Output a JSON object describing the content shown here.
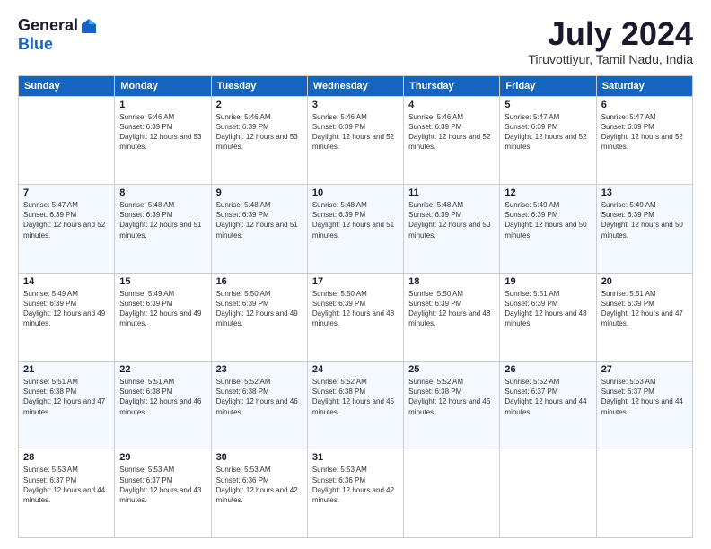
{
  "header": {
    "logo_general": "General",
    "logo_blue": "Blue",
    "month_title": "July 2024",
    "location": "Tiruvottiyur, Tamil Nadu, India"
  },
  "weekdays": [
    "Sunday",
    "Monday",
    "Tuesday",
    "Wednesday",
    "Thursday",
    "Friday",
    "Saturday"
  ],
  "weeks": [
    [
      {
        "day": "",
        "sunrise": "",
        "sunset": "",
        "daylight": ""
      },
      {
        "day": "1",
        "sunrise": "Sunrise: 5:46 AM",
        "sunset": "Sunset: 6:39 PM",
        "daylight": "Daylight: 12 hours and 53 minutes."
      },
      {
        "day": "2",
        "sunrise": "Sunrise: 5:46 AM",
        "sunset": "Sunset: 6:39 PM",
        "daylight": "Daylight: 12 hours and 53 minutes."
      },
      {
        "day": "3",
        "sunrise": "Sunrise: 5:46 AM",
        "sunset": "Sunset: 6:39 PM",
        "daylight": "Daylight: 12 hours and 52 minutes."
      },
      {
        "day": "4",
        "sunrise": "Sunrise: 5:46 AM",
        "sunset": "Sunset: 6:39 PM",
        "daylight": "Daylight: 12 hours and 52 minutes."
      },
      {
        "day": "5",
        "sunrise": "Sunrise: 5:47 AM",
        "sunset": "Sunset: 6:39 PM",
        "daylight": "Daylight: 12 hours and 52 minutes."
      },
      {
        "day": "6",
        "sunrise": "Sunrise: 5:47 AM",
        "sunset": "Sunset: 6:39 PM",
        "daylight": "Daylight: 12 hours and 52 minutes."
      }
    ],
    [
      {
        "day": "7",
        "sunrise": "Sunrise: 5:47 AM",
        "sunset": "Sunset: 6:39 PM",
        "daylight": "Daylight: 12 hours and 52 minutes."
      },
      {
        "day": "8",
        "sunrise": "Sunrise: 5:48 AM",
        "sunset": "Sunset: 6:39 PM",
        "daylight": "Daylight: 12 hours and 51 minutes."
      },
      {
        "day": "9",
        "sunrise": "Sunrise: 5:48 AM",
        "sunset": "Sunset: 6:39 PM",
        "daylight": "Daylight: 12 hours and 51 minutes."
      },
      {
        "day": "10",
        "sunrise": "Sunrise: 5:48 AM",
        "sunset": "Sunset: 6:39 PM",
        "daylight": "Daylight: 12 hours and 51 minutes."
      },
      {
        "day": "11",
        "sunrise": "Sunrise: 5:48 AM",
        "sunset": "Sunset: 6:39 PM",
        "daylight": "Daylight: 12 hours and 50 minutes."
      },
      {
        "day": "12",
        "sunrise": "Sunrise: 5:49 AM",
        "sunset": "Sunset: 6:39 PM",
        "daylight": "Daylight: 12 hours and 50 minutes."
      },
      {
        "day": "13",
        "sunrise": "Sunrise: 5:49 AM",
        "sunset": "Sunset: 6:39 PM",
        "daylight": "Daylight: 12 hours and 50 minutes."
      }
    ],
    [
      {
        "day": "14",
        "sunrise": "Sunrise: 5:49 AM",
        "sunset": "Sunset: 6:39 PM",
        "daylight": "Daylight: 12 hours and 49 minutes."
      },
      {
        "day": "15",
        "sunrise": "Sunrise: 5:49 AM",
        "sunset": "Sunset: 6:39 PM",
        "daylight": "Daylight: 12 hours and 49 minutes."
      },
      {
        "day": "16",
        "sunrise": "Sunrise: 5:50 AM",
        "sunset": "Sunset: 6:39 PM",
        "daylight": "Daylight: 12 hours and 49 minutes."
      },
      {
        "day": "17",
        "sunrise": "Sunrise: 5:50 AM",
        "sunset": "Sunset: 6:39 PM",
        "daylight": "Daylight: 12 hours and 48 minutes."
      },
      {
        "day": "18",
        "sunrise": "Sunrise: 5:50 AM",
        "sunset": "Sunset: 6:39 PM",
        "daylight": "Daylight: 12 hours and 48 minutes."
      },
      {
        "day": "19",
        "sunrise": "Sunrise: 5:51 AM",
        "sunset": "Sunset: 6:39 PM",
        "daylight": "Daylight: 12 hours and 48 minutes."
      },
      {
        "day": "20",
        "sunrise": "Sunrise: 5:51 AM",
        "sunset": "Sunset: 6:39 PM",
        "daylight": "Daylight: 12 hours and 47 minutes."
      }
    ],
    [
      {
        "day": "21",
        "sunrise": "Sunrise: 5:51 AM",
        "sunset": "Sunset: 6:38 PM",
        "daylight": "Daylight: 12 hours and 47 minutes."
      },
      {
        "day": "22",
        "sunrise": "Sunrise: 5:51 AM",
        "sunset": "Sunset: 6:38 PM",
        "daylight": "Daylight: 12 hours and 46 minutes."
      },
      {
        "day": "23",
        "sunrise": "Sunrise: 5:52 AM",
        "sunset": "Sunset: 6:38 PM",
        "daylight": "Daylight: 12 hours and 46 minutes."
      },
      {
        "day": "24",
        "sunrise": "Sunrise: 5:52 AM",
        "sunset": "Sunset: 6:38 PM",
        "daylight": "Daylight: 12 hours and 45 minutes."
      },
      {
        "day": "25",
        "sunrise": "Sunrise: 5:52 AM",
        "sunset": "Sunset: 6:38 PM",
        "daylight": "Daylight: 12 hours and 45 minutes."
      },
      {
        "day": "26",
        "sunrise": "Sunrise: 5:52 AM",
        "sunset": "Sunset: 6:37 PM",
        "daylight": "Daylight: 12 hours and 44 minutes."
      },
      {
        "day": "27",
        "sunrise": "Sunrise: 5:53 AM",
        "sunset": "Sunset: 6:37 PM",
        "daylight": "Daylight: 12 hours and 44 minutes."
      }
    ],
    [
      {
        "day": "28",
        "sunrise": "Sunrise: 5:53 AM",
        "sunset": "Sunset: 6:37 PM",
        "daylight": "Daylight: 12 hours and 44 minutes."
      },
      {
        "day": "29",
        "sunrise": "Sunrise: 5:53 AM",
        "sunset": "Sunset: 6:37 PM",
        "daylight": "Daylight: 12 hours and 43 minutes."
      },
      {
        "day": "30",
        "sunrise": "Sunrise: 5:53 AM",
        "sunset": "Sunset: 6:36 PM",
        "daylight": "Daylight: 12 hours and 42 minutes."
      },
      {
        "day": "31",
        "sunrise": "Sunrise: 5:53 AM",
        "sunset": "Sunset: 6:36 PM",
        "daylight": "Daylight: 12 hours and 42 minutes."
      },
      {
        "day": "",
        "sunrise": "",
        "sunset": "",
        "daylight": ""
      },
      {
        "day": "",
        "sunrise": "",
        "sunset": "",
        "daylight": ""
      },
      {
        "day": "",
        "sunrise": "",
        "sunset": "",
        "daylight": ""
      }
    ]
  ]
}
